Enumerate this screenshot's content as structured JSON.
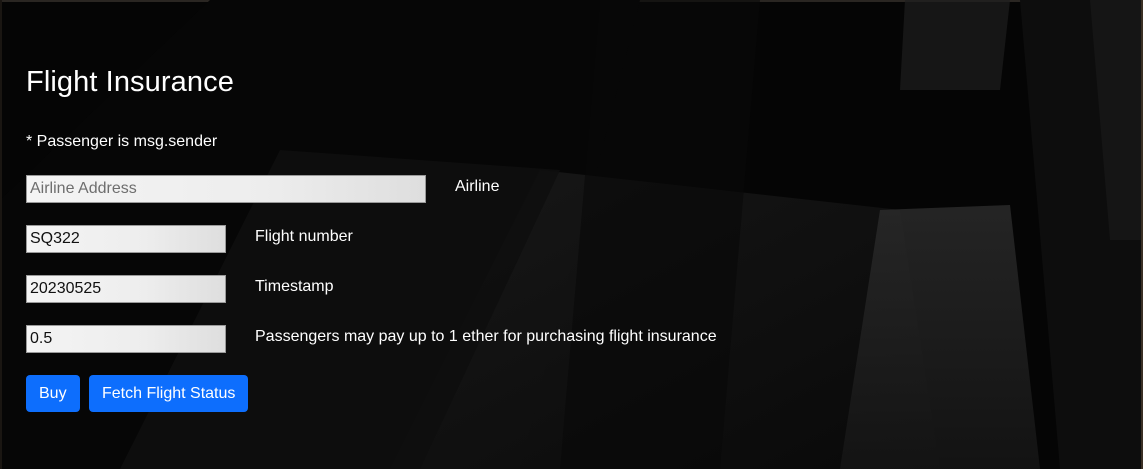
{
  "page": {
    "title": "Flight Insurance",
    "note": "* Passenger is msg.sender"
  },
  "form": {
    "airline": {
      "value": "",
      "placeholder": "Airline Address",
      "label": "Airline"
    },
    "flight_number": {
      "value": "SQ322",
      "label": "Flight number"
    },
    "timestamp": {
      "value": "20230525",
      "label": "Timestamp"
    },
    "amount": {
      "value": "0.5",
      "label": "Passengers may pay up to 1 ether for purchasing flight insurance"
    }
  },
  "actions": {
    "buy_label": "Buy",
    "fetch_label": "Fetch Flight Status"
  },
  "colors": {
    "background": "#050505",
    "button": "#0d6efd",
    "text": "#ffffff"
  }
}
